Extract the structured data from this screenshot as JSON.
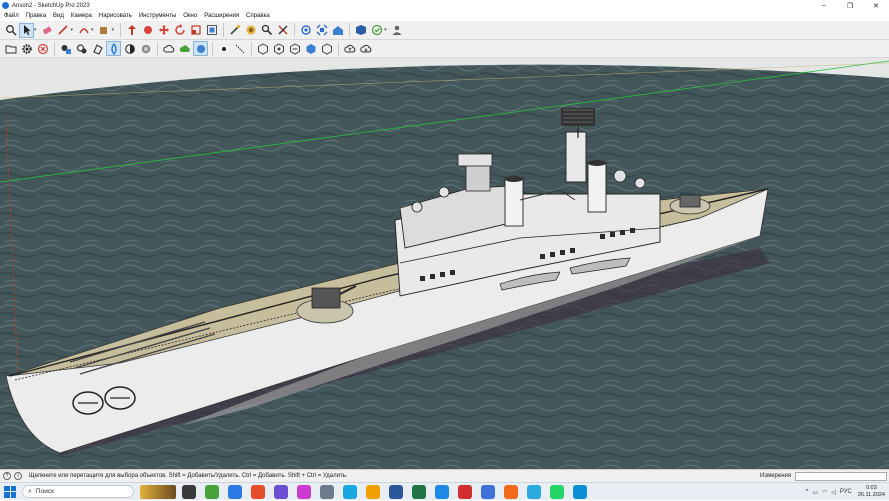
{
  "window": {
    "title": "Anson2 - SketchUp Pro 2023",
    "min_glyph": "–",
    "max_glyph": "❐",
    "close_glyph": "✕"
  },
  "menu": {
    "items": [
      "Файл",
      "Правка",
      "Вид",
      "Камера",
      "Нарисовать",
      "Инструменты",
      "Окно",
      "Расширения",
      "Справка"
    ]
  },
  "toolbar_top": {
    "icons": [
      "search-icon",
      "select-arrow-icon",
      "eraser-icon",
      "pencil-line-icon",
      "arc-icon",
      "paint-bucket-icon",
      "push-pull-icon",
      "follow-me-icon",
      "move-icon",
      "rotate-icon",
      "scale-icon",
      "offset-icon",
      "tape-measure-icon",
      "paint-icon",
      "orbit-icon",
      "pan-icon",
      "zoom-icon",
      "zoom-extents-icon",
      "warehouse-icon",
      "extension-warehouse-icon",
      "layout-icon",
      "send-icon",
      "account-icon"
    ]
  },
  "toolbar_second": {
    "icons": [
      "folder-open-icon",
      "gear-icon",
      "no-entry-icon",
      "component-icon",
      "group-icon",
      "components-3d-icon",
      "style-xray-icon",
      "style-shaded-icon",
      "style-textured-icon",
      "dot-icon",
      "dimension-icon",
      "section-icon",
      "hexagon-icon",
      "hexagon-icon",
      "hexagon-icon",
      "hexagon-icon",
      "cloud-upload-icon",
      "cloud-download-icon"
    ]
  },
  "viewport": {
    "sky_color": "#e4e7e5",
    "sea_color": "#3f5256",
    "hull_color": "#ececec",
    "deck_color": "#c6bd9c",
    "axis_green": "#2bbf3a",
    "axis_red": "#c23a2a"
  },
  "status": {
    "hint": "Щелкните или перетащите для выбора объектов. Shift = Добавить/Удалить. Ctrl = Добавить. Shift + Ctrl = Удалить.",
    "measure_label": "Измерения"
  },
  "taskbar": {
    "search_placeholder": "Поиск",
    "app_colors": [
      "#3a3a3a",
      "#48a23b",
      "#2c7be5",
      "#e34d2a",
      "#6a4fd0",
      "#c93ccf",
      "#6c7a8a",
      "#18a7e0",
      "#f0a000",
      "#2b579a",
      "#217346",
      "#1e88e5",
      "#d12f2f",
      "#3f72d8",
      "#f06a1e",
      "#2aa8e0",
      "#25d366",
      "#0a8fd6"
    ],
    "lang": "РУС",
    "time": "0:03",
    "date": "26.11.2024"
  }
}
